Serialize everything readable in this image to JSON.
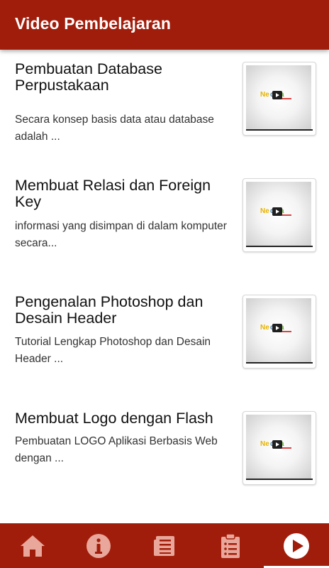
{
  "app_bar": {
    "title": "Video Pembelajaran"
  },
  "videos": [
    {
      "title": "Pembuatan Database Perpustakaan",
      "description": "Secara konsep basis data atau database adalah ...",
      "thumbnail_icon": "video-thumbnail-icon"
    },
    {
      "title": "Membuat Relasi dan Foreign Key",
      "description": "informasi yang disimpan di dalam komputer secara...",
      "thumbnail_icon": "video-thumbnail-icon"
    },
    {
      "title": "Pengenalan Photoshop dan Desain Header",
      "description": "Tutorial Lengkap Photoshop dan Desain Header ...",
      "thumbnail_icon": "video-thumbnail-icon"
    },
    {
      "title": "Membuat Logo dengan Flash",
      "description": "Pembuatan LOGO Aplikasi Berbasis Web dengan ...",
      "thumbnail_icon": "video-thumbnail-icon"
    }
  ],
  "bottom_nav": {
    "items": [
      {
        "icon": "home-icon",
        "active": false
      },
      {
        "icon": "info-icon",
        "active": false
      },
      {
        "icon": "newspaper-icon",
        "active": false
      },
      {
        "icon": "clipboard-list-icon",
        "active": false
      },
      {
        "icon": "play-circle-icon",
        "active": true
      }
    ]
  },
  "colors": {
    "primary": "#a11d0b",
    "inactive_icon": "#e8a79a",
    "active_icon": "#ffffff"
  }
}
